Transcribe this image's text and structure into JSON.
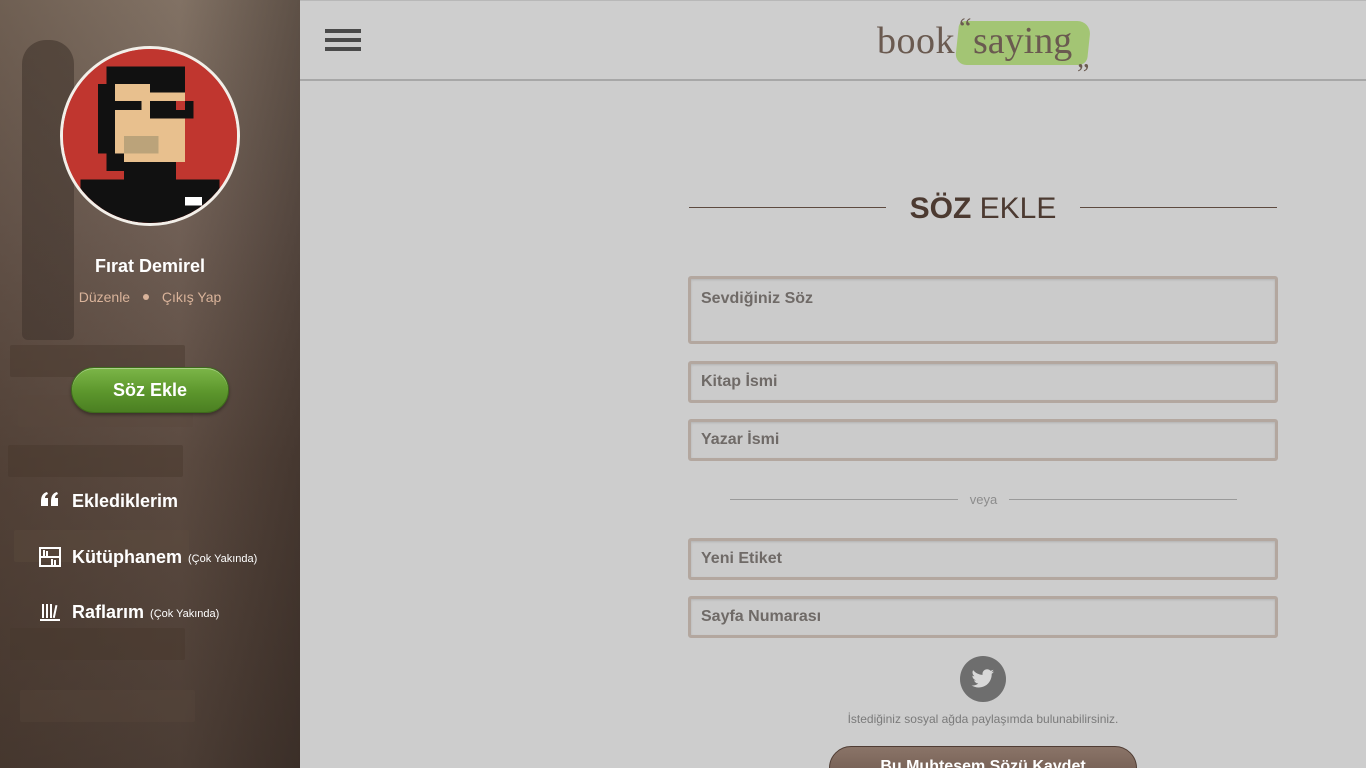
{
  "sidebar": {
    "user_name": "Fırat Demirel",
    "edit_link": "Düzenle",
    "logout_link": "Çıkış Yap",
    "add_button": "Söz Ekle",
    "nav": [
      {
        "label": "Eklediklerim",
        "note": "",
        "icon": "quote-icon"
      },
      {
        "label": "Kütüphanem",
        "note": "(Çok Yakında)",
        "icon": "library-icon"
      },
      {
        "label": "Raflarım",
        "note": "(Çok Yakında)",
        "icon": "shelves-icon"
      }
    ]
  },
  "header": {
    "logo_part1": "book",
    "logo_part2": "saying",
    "open_quote": "“",
    "close_quote": "„"
  },
  "form": {
    "title_bold": "SÖZ",
    "title_rest": " EKLE",
    "quote_placeholder": "Sevdiğiniz Söz",
    "book_placeholder": "Kitap İsmi",
    "author_placeholder": "Yazar İsmi",
    "divider": "veya",
    "tag_placeholder": "Yeni Etiket",
    "page_placeholder": "Sayfa Numarası",
    "share_note": "İstediğiniz sosyal ağda paylaşımda bulunabilirsiniz.",
    "save_button": "Bu Muhteşem Sözü Kaydet"
  },
  "colors": {
    "accent_green": "#5c962c",
    "logo_highlight": "#9ec46a",
    "brown": "#4c3a31"
  }
}
